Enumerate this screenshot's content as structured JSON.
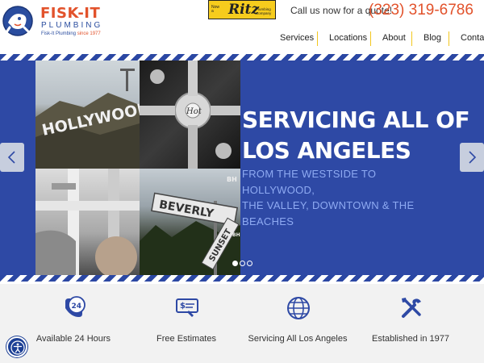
{
  "header": {
    "brand_name": "FISK-IT",
    "brand_sub": "PLUMBING",
    "brand_since_prefix": "Fisk-It Plumbing",
    "brand_since_suffix": "since 1977",
    "badge": {
      "pre": "Now a",
      "word": "Ritz",
      "post": "Plumbing Company"
    },
    "call_text": "Call us now for a quote!",
    "phone": "(323) 319-6786"
  },
  "nav": {
    "items": [
      {
        "label": "Services"
      },
      {
        "label": "Locations"
      },
      {
        "label": "About"
      },
      {
        "label": "Blog"
      },
      {
        "label": "Contact"
      }
    ]
  },
  "hero": {
    "title_line1": "SERVICING ALL OF",
    "title_line2": "LOS ANGELES",
    "subtitle_lines": [
      "FROM THE WESTSIDE TO",
      "HOLLYWOOD,",
      "THE VALLEY, DOWNTOWN & THE",
      "BEACHES"
    ],
    "tiles": {
      "hollywood_sign": "HOLLYWOOD",
      "faucet_handle": "Hot",
      "beverly_sign": "BEVERLY",
      "beverly_block": "BH",
      "sunset_sign": "SUNSET",
      "sunset_block": "BH"
    },
    "slide_active_index": 0,
    "slide_count": 3
  },
  "features": [
    {
      "label": "Available 24 Hours",
      "icon": "phone-24-icon"
    },
    {
      "label": "Free Estimates",
      "icon": "estimate-icon"
    },
    {
      "label": "Servicing All Los Angeles",
      "icon": "globe-icon"
    },
    {
      "label": "Established in 1977",
      "icon": "tools-icon"
    }
  ],
  "colors": {
    "brand_orange": "#e2522b",
    "brand_blue": "#2e49a5",
    "nav_separator": "#f3c71e",
    "subtitle_blue": "#8eaaf2"
  }
}
